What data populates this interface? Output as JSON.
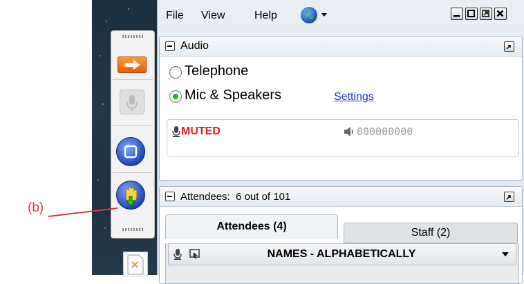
{
  "callout": {
    "label": "(b)"
  },
  "menubar": {
    "items": [
      "File",
      "View",
      "Help"
    ]
  },
  "audio": {
    "title": "Audio",
    "options": [
      {
        "label": "Telephone",
        "selected": false
      },
      {
        "label": "Mic & Speakers",
        "selected": true
      }
    ],
    "settings_link": "Settings",
    "mic_status": "MUTED",
    "volume_meter": "000000000"
  },
  "attendees_panel": {
    "title": "Attendees:  6 out of 101",
    "tabs": [
      {
        "label": "Attendees (4)",
        "active": true
      },
      {
        "label": "Staff (2)",
        "active": false
      }
    ],
    "list_header": "NAMES - ALPHABETICALLY"
  },
  "icons": [
    "arrow-icon",
    "microphone-icon",
    "stop-icon",
    "raise-hand-icon",
    "globe-icon",
    "minimize-icon",
    "maximize-icon",
    "restore-icon",
    "close-icon",
    "speaker-icon",
    "screen-icon",
    "file-icon"
  ],
  "colors": {
    "muted": "#e01b1b",
    "link": "#1a33cc",
    "orange": "#f07a14",
    "accent_blue": "#2346b5",
    "callout": "#d43b3b"
  }
}
